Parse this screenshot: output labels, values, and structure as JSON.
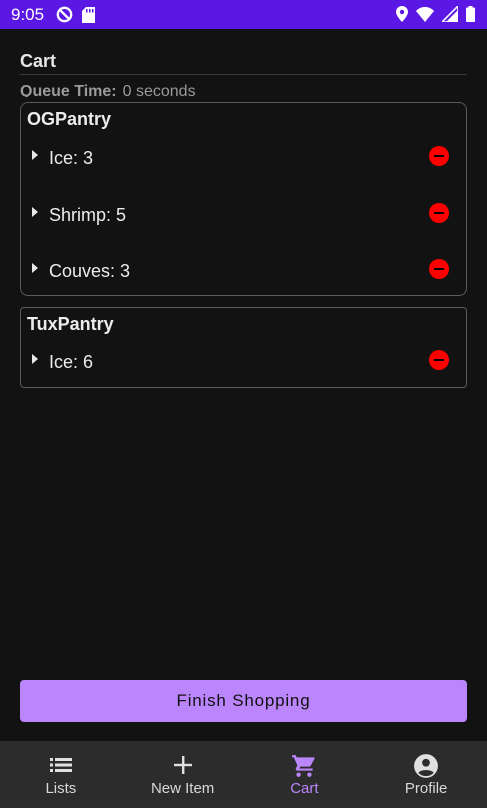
{
  "status_bar": {
    "time": "9:05"
  },
  "page": {
    "title": "Cart",
    "queue_label": "Queue Time:",
    "queue_value": "0 seconds"
  },
  "pantries": [
    {
      "name": "OGPantry",
      "items": [
        {
          "label": "Ice: 3"
        },
        {
          "label": "Shrimp: 5"
        },
        {
          "label": "Couves: 3"
        }
      ]
    },
    {
      "name": "TuxPantry",
      "items": [
        {
          "label": "Ice: 6"
        }
      ]
    }
  ],
  "finish_button": {
    "label": "Finish Shopping"
  },
  "bottom_nav": {
    "items": [
      {
        "label": "Lists",
        "icon": "list-icon"
      },
      {
        "label": "New Item",
        "icon": "plus-icon"
      },
      {
        "label": "Cart",
        "icon": "cart-icon",
        "active": true
      },
      {
        "label": "Profile",
        "icon": "account-circle-icon"
      }
    ]
  },
  "colors": {
    "status_bar": "#5b17e4",
    "background": "#121212",
    "accent": "#bb86fc",
    "remove": "#ff0000",
    "nav_background": "#2c2c2c"
  }
}
